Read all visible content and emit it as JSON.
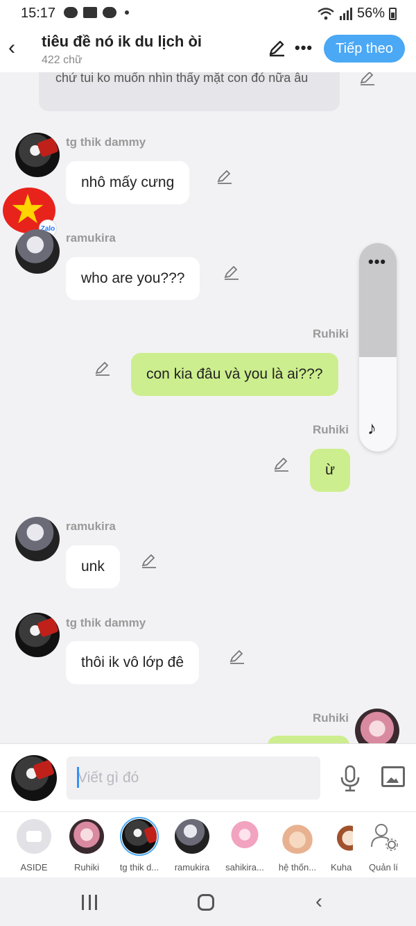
{
  "status_bar": {
    "time": "15:17",
    "battery": "56%"
  },
  "header": {
    "title": "tiêu đề nó ik du lịch òi",
    "word_count": "422 chữ",
    "next_button": "Tiếp theo",
    "more_icon": "more-horizontal-icon",
    "edit_icon": "pencil-icon"
  },
  "messages": [
    {
      "sender": "",
      "text": "chứ tui ko muốn nhìn thấy mặt con đó nữa âu",
      "side": "left",
      "partial": true
    },
    {
      "sender": "tg thik dammy",
      "text": "nhô mấy cưng",
      "side": "left"
    },
    {
      "sender": "ramukira",
      "text": "who are you???",
      "side": "left"
    },
    {
      "sender": "Ruhiki",
      "text": "con kia đâu và you là ai???",
      "side": "right"
    },
    {
      "sender": "Ruhiki",
      "text": "ừ",
      "side": "right"
    },
    {
      "sender": "ramukira",
      "text": "unk",
      "side": "left"
    },
    {
      "sender": "tg thik dammy",
      "text": "thôi ik vô lớp đê",
      "side": "left"
    },
    {
      "sender": "Ruhiki",
      "text": "",
      "side": "right",
      "partial": true
    }
  ],
  "overlay": {
    "badge_text": "Zalo"
  },
  "composer": {
    "placeholder": "Viết gì đó"
  },
  "characters": [
    {
      "name": "ASIDE"
    },
    {
      "name": "Ruhiki"
    },
    {
      "name": "tg thik d..."
    },
    {
      "name": "ramukira"
    },
    {
      "name": "sahikira..."
    },
    {
      "name": "hệ thốn..."
    },
    {
      "name": "Kuha"
    },
    {
      "name": "Quản lí"
    }
  ],
  "colors": {
    "accent": "#4aa8f5",
    "bubble_right": "#cdee8e",
    "bubble_left": "#ffffff",
    "background": "#f2f2f4"
  }
}
